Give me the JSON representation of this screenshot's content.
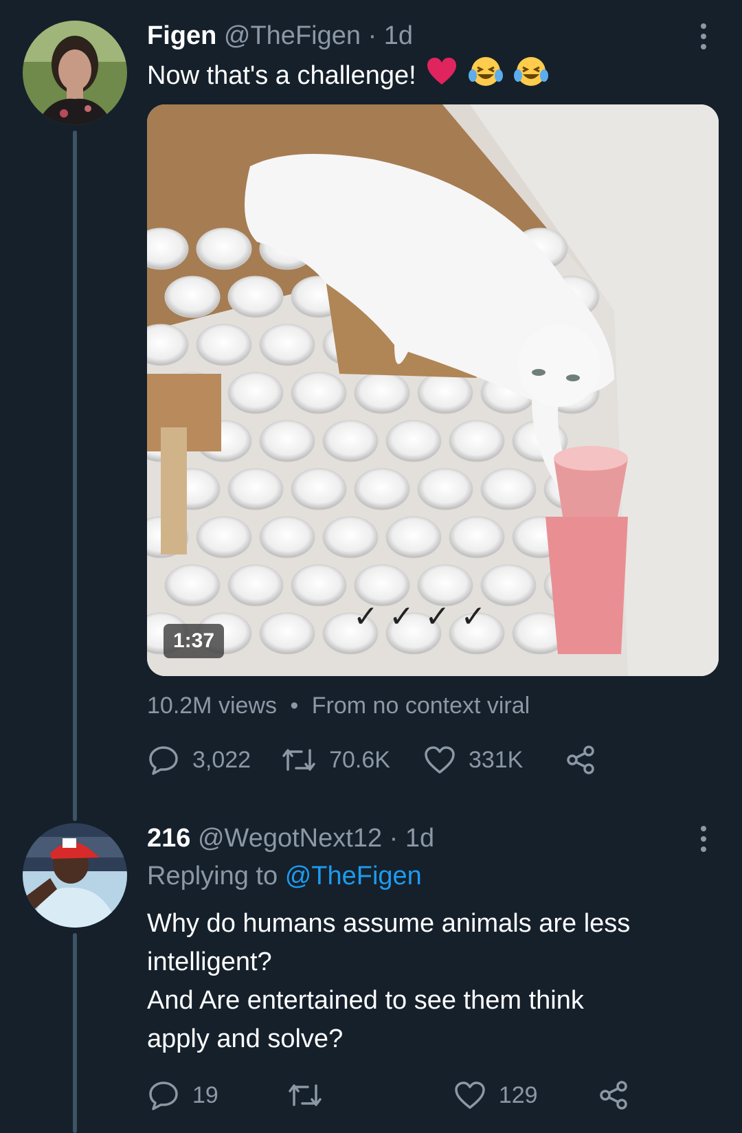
{
  "tweet": {
    "name": "Figen",
    "handle": "@TheFigen",
    "time": "· 1d",
    "text": "Now that's a challenge!",
    "emojis": [
      "heart",
      "face-with-tears-of-joy",
      "face-with-tears-of-joy"
    ],
    "video_duration": "1:37",
    "video_overlay_marks": "✓ ✓ ✓ ✓",
    "views": "10.2M views",
    "separator": "•",
    "source": "From no context viral",
    "replies": "3,022",
    "retweets": "70.6K",
    "likes": "331K"
  },
  "reply": {
    "name": "216",
    "handle": "@WegotNext12",
    "time": "· 1d",
    "replying_prefix": "Replying to",
    "replying_to": "@TheFigen",
    "text_lines": [
      "Why do humans assume animals are less",
      "intelligent?",
      "And Are entertained to see them think",
      "apply and solve?"
    ],
    "replies": "19",
    "retweets": "",
    "likes": "129"
  },
  "icons": [
    "more-icon",
    "reply-icon",
    "retweet-icon",
    "like-icon",
    "share-icon"
  ],
  "colors": {
    "background": "#15202b",
    "secondary_text": "#8b98a5",
    "link": "#1d9bf0",
    "thread_line": "#3d5466"
  }
}
